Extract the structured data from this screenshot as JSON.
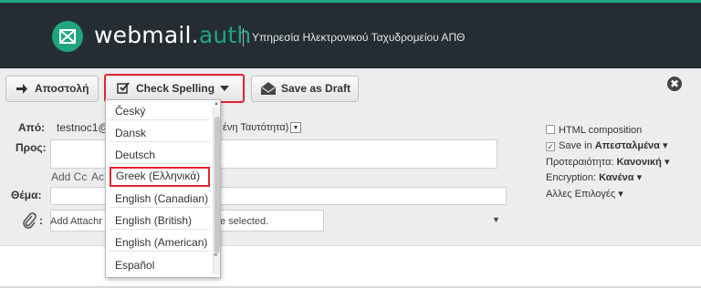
{
  "header": {
    "brand_main": "webmail.",
    "brand_suffix": "auth",
    "separator": "|",
    "subtitle": "Υπηρεσία Ηλεκτρονικού Ταχυδρομείου ΑΠΘ",
    "accent_color": "#1fa680",
    "bar_color": "#252d33"
  },
  "toolbar": {
    "send_label": "Αποστολή",
    "spell_label": "Check Spelling",
    "draft_label": "Save as Draft",
    "close_symbol": "✖"
  },
  "form": {
    "from_label": "Από:",
    "from_value": "testnoc1@",
    "from_identity": "ένη Ταυτότητα)",
    "to_label": "Προς:",
    "add_cc": "Add Cc",
    "add_bcc": "Ac",
    "subject_label": "Θέμα:",
    "attach_colon": ":",
    "attach_left": "Add Attachr",
    "attach_right": "e selected."
  },
  "options": {
    "html_composition": "HTML composition",
    "save_in_label": "Save in",
    "save_in_value": "Απεσταλμένα",
    "priority_label": "Προτεραιότητα:",
    "priority_value": "Κανονική",
    "encryption_label": "Encryption:",
    "encryption_value": "Κανένα",
    "more_options": "Αλλες Επιλογές"
  },
  "spellcheck_languages": [
    "Český",
    "Dansk",
    "Deutsch",
    "Greek (Ελληνικά)",
    "English (Canadian)",
    "English (British)",
    "English (American)",
    "Español"
  ],
  "highlight_color": "#e0252e"
}
